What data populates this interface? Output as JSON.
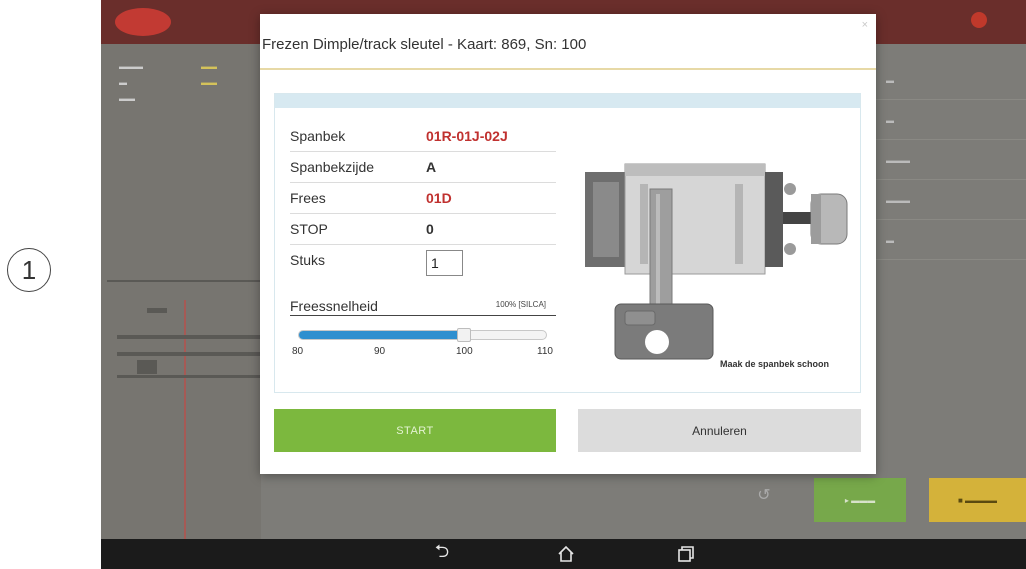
{
  "step_marker": "1",
  "dialog": {
    "title": "Frezen Dimple/track sleutel - Kaart: 869, Sn: 100",
    "close_glyph": "×",
    "params": [
      {
        "label": "Spanbek",
        "value": "01R-01J-02J",
        "color": "#c0312f"
      },
      {
        "label": "Spanbekzijde",
        "value": "A",
        "color": "#333333"
      },
      {
        "label": "Frees",
        "value": "01D",
        "color": "#c0312f"
      },
      {
        "label": "STOP",
        "value": "0",
        "color": "#333333"
      }
    ],
    "quantity": {
      "label": "Stuks",
      "value": "1"
    },
    "speed": {
      "label": "Freessnelheid",
      "percent_text": "100% [SILCA]",
      "min": 80,
      "max": 110,
      "value": 100,
      "ticks": [
        "80",
        "90",
        "100",
        "110"
      ]
    },
    "fixture_caption": "Maak de spanbek schoon",
    "start_label": "START",
    "cancel_label": "Annuleren"
  },
  "colors": {
    "start_green": "#7cb83e",
    "slider_blue": "#2f8fcf",
    "header_accent": "#e7d9a6",
    "value_red": "#c0312f"
  },
  "navbar": {
    "icons": [
      "back-icon",
      "home-icon",
      "recent-apps-icon"
    ],
    "back_glyph": "⮌",
    "home_glyph": "⌂",
    "recent_glyph": "❐"
  }
}
